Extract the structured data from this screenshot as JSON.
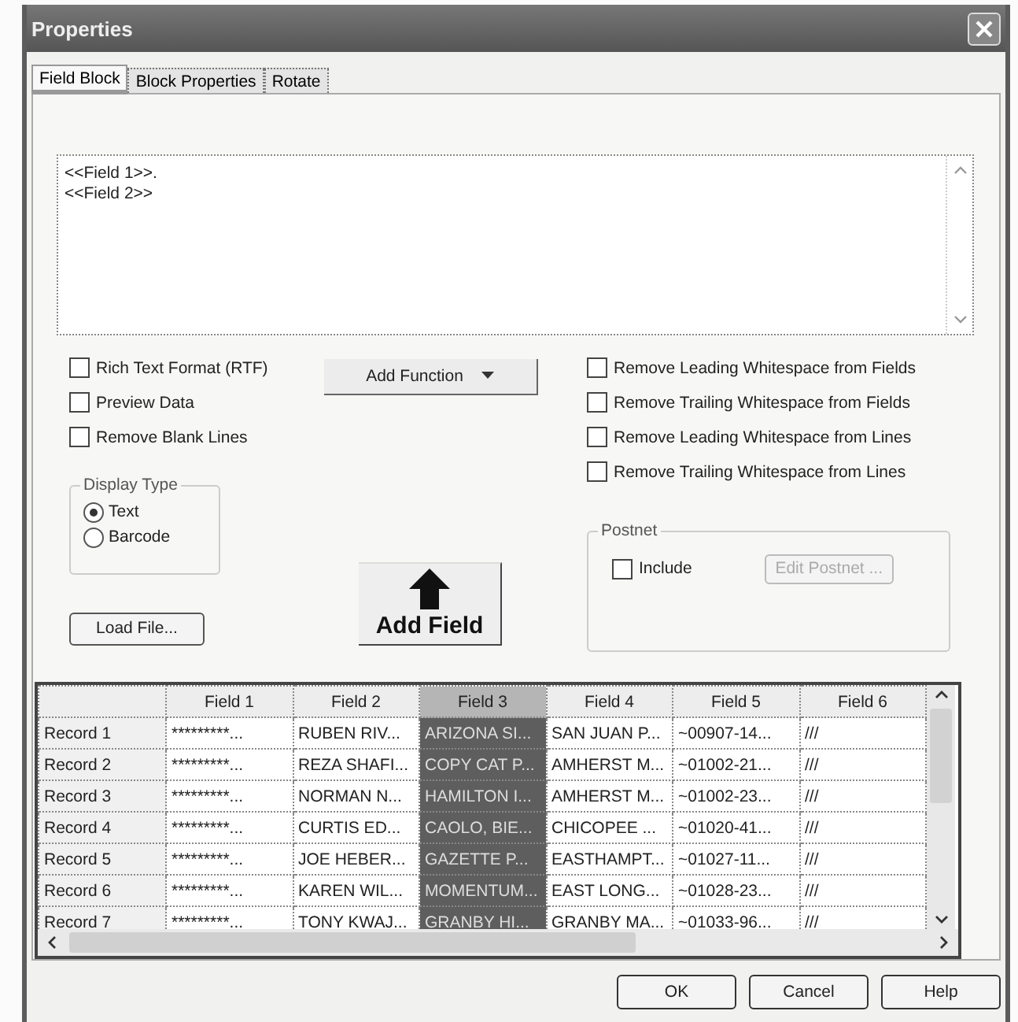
{
  "window": {
    "title": "Properties"
  },
  "tabs": [
    {
      "label": "Field Block",
      "selected": true
    },
    {
      "label": "Block Properties",
      "selected": false
    },
    {
      "label": "Rotate",
      "selected": false
    }
  ],
  "editor": {
    "lines": [
      "<<Field 1>>.",
      "<<Field 2>>"
    ]
  },
  "options_left": [
    {
      "label": "Rich Text Format (RTF)",
      "checked": false
    },
    {
      "label": "Preview Data",
      "checked": false
    },
    {
      "label": "Remove Blank Lines",
      "checked": false
    }
  ],
  "add_function": {
    "label": "Add Function"
  },
  "options_right": [
    {
      "label": "Remove Leading Whitespace from Fields",
      "checked": false
    },
    {
      "label": "Remove Trailing Whitespace from Fields",
      "checked": false
    },
    {
      "label": "Remove Leading Whitespace from Lines",
      "checked": false
    },
    {
      "label": "Remove Trailing Whitespace from Lines",
      "checked": false
    }
  ],
  "display_type": {
    "title": "Display Type",
    "options": [
      {
        "label": "Text",
        "selected": true
      },
      {
        "label": "Barcode",
        "selected": false
      }
    ]
  },
  "postnet": {
    "title": "Postnet",
    "include": {
      "label": "Include",
      "checked": false
    },
    "edit_button": {
      "label": "Edit Postnet ...",
      "disabled": true
    }
  },
  "load_file": {
    "label": "Load File..."
  },
  "add_field": {
    "label": "Add Field"
  },
  "grid": {
    "columns": [
      {
        "label": "Field 1",
        "selected": false
      },
      {
        "label": "Field 2",
        "selected": false
      },
      {
        "label": "Field 3",
        "selected": true
      },
      {
        "label": "Field 4",
        "selected": false
      },
      {
        "label": "Field 5",
        "selected": false
      },
      {
        "label": "Field 6",
        "selected": false
      }
    ],
    "rows": [
      {
        "label": "Record 1",
        "cells": [
          "*********...",
          "RUBEN RIV...",
          "ARIZONA SI...",
          "SAN JUAN P...",
          "~00907-14...",
          "///"
        ]
      },
      {
        "label": "Record 2",
        "cells": [
          "*********...",
          "REZA SHAFI...",
          "COPY CAT P...",
          "AMHERST M...",
          "~01002-21...",
          "///"
        ]
      },
      {
        "label": "Record 3",
        "cells": [
          "*********...",
          "NORMAN N...",
          "HAMILTON I...",
          "AMHERST M...",
          "~01002-23...",
          "///"
        ]
      },
      {
        "label": "Record 4",
        "cells": [
          "*********...",
          "CURTIS ED...",
          "CAOLO, BIE...",
          "CHICOPEE ...",
          "~01020-41...",
          "///"
        ]
      },
      {
        "label": "Record 5",
        "cells": [
          "*********...",
          "JOE HEBER...",
          "GAZETTE P...",
          "EASTHAMPT...",
          "~01027-11...",
          "///"
        ]
      },
      {
        "label": "Record 6",
        "cells": [
          "*********...",
          "KAREN WIL...",
          "MOMENTUM...",
          "EAST LONG...",
          "~01028-23...",
          "///"
        ]
      },
      {
        "label": "Record 7",
        "cells": [
          "*********...",
          "TONY KWAJ...",
          "GRANBY HI...",
          "GRANBY MA...",
          "~01033-96...",
          "///"
        ]
      }
    ]
  },
  "buttons": [
    {
      "label": "OK"
    },
    {
      "label": "Cancel"
    },
    {
      "label": "Help"
    }
  ]
}
